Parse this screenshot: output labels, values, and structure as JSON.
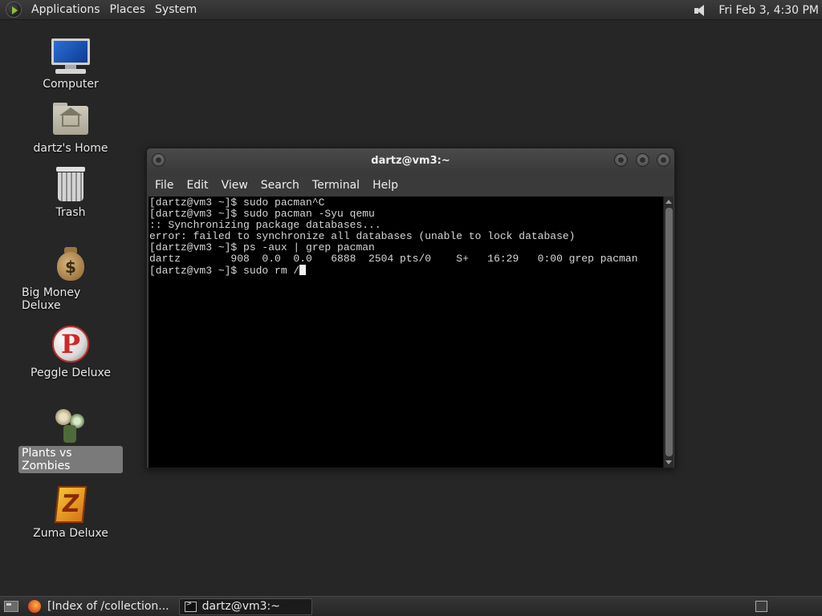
{
  "top_panel": {
    "menus": [
      "Applications",
      "Places",
      "System"
    ],
    "clock": "Fri Feb  3,  4:30 PM"
  },
  "desktop_icons": [
    {
      "label": "Computer",
      "icon": "computer-icon"
    },
    {
      "label": "dartz's Home",
      "icon": "home-folder-icon"
    },
    {
      "label": "Trash",
      "icon": "trash-icon"
    },
    {
      "label": "Big Money Deluxe",
      "icon": "money-bag-icon"
    },
    {
      "label": "Peggle Deluxe",
      "icon": "peggle-icon"
    },
    {
      "label": "Plants vs Zombies",
      "icon": "plants-vs-zombies-icon",
      "selected": true
    },
    {
      "label": "Zuma Deluxe",
      "icon": "zuma-icon"
    }
  ],
  "terminal": {
    "title": "dartz@vm3:~",
    "menu": [
      "File",
      "Edit",
      "View",
      "Search",
      "Terminal",
      "Help"
    ],
    "lines": [
      "[dartz@vm3 ~]$ sudo pacman^C",
      "[dartz@vm3 ~]$ sudo pacman -Syu qemu",
      ":: Synchronizing package databases...",
      "error: failed to synchronize all databases (unable to lock database)",
      "[dartz@vm3 ~]$ ps -aux | grep pacman",
      "dartz        908  0.0  0.0   6888  2504 pts/0    S+   16:29   0:00 grep pacman"
    ],
    "current_line": "[dartz@vm3 ~]$ sudo rm /"
  },
  "taskbar": {
    "tasks": [
      {
        "label": "[Index of /collection...",
        "icon": "firefox-icon",
        "active": false
      },
      {
        "label": "dartz@vm3:~",
        "icon": "terminal-icon",
        "active": true
      }
    ]
  }
}
